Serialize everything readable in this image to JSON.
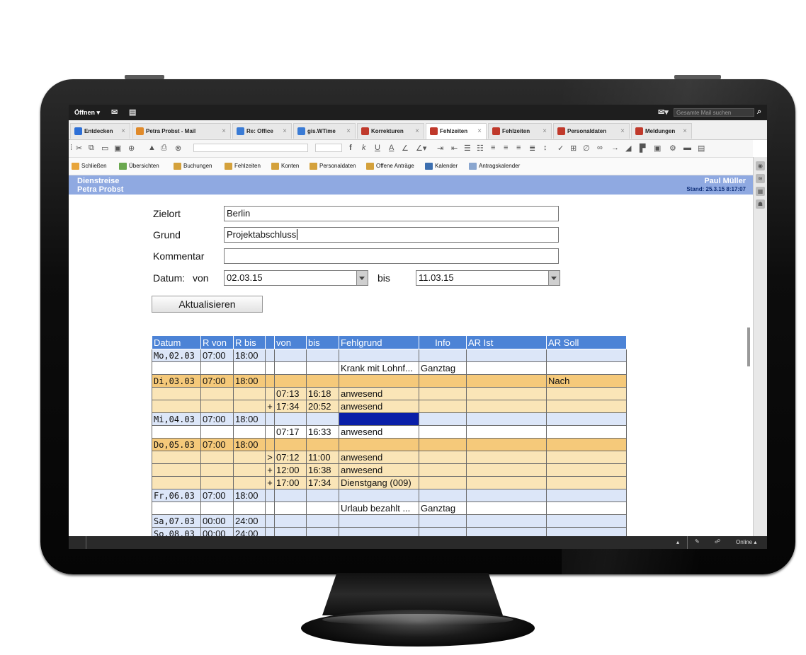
{
  "topbar": {
    "open_label": "Öffnen",
    "mail_search_placeholder": "Gesamte Mail suchen"
  },
  "tabs": [
    {
      "label": "Entdecken",
      "icon": "info-icon",
      "color": "#2d6fd6",
      "active": false
    },
    {
      "label": "Petra Probst - Mail",
      "icon": "mail-icon",
      "color": "#e08a2a",
      "active": false
    },
    {
      "label": "Re: Office",
      "icon": "reply-icon",
      "color": "#3a7bd5",
      "active": false
    },
    {
      "label": "gis.WTime",
      "icon": "app-icon",
      "color": "#3a7bd5",
      "active": false
    },
    {
      "label": "Korrekturen",
      "icon": "app-icon",
      "color": "#c0392b",
      "active": false
    },
    {
      "label": "Fehlzeiten",
      "icon": "app-icon",
      "color": "#c0392b",
      "active": true
    },
    {
      "label": "Fehlzeiten",
      "icon": "app-icon",
      "color": "#c0392b",
      "active": false
    },
    {
      "label": "Personaldaten",
      "icon": "app-icon",
      "color": "#c0392b",
      "active": false
    },
    {
      "label": "Meldungen",
      "icon": "app-icon",
      "color": "#c0392b",
      "active": false
    }
  ],
  "actions": [
    {
      "label": "Schließen",
      "icon": "close-app-icon",
      "color": "#e8a53b"
    },
    {
      "label": "Übersichten",
      "icon": "overview-icon",
      "color": "#6aa84f"
    },
    {
      "label": "Buchungen",
      "icon": "booking-icon",
      "color": "#d4a13b"
    },
    {
      "label": "Fehlzeiten",
      "icon": "absence-icon",
      "color": "#d4a13b"
    },
    {
      "label": "Konten",
      "icon": "accounts-icon",
      "color": "#d4a13b"
    },
    {
      "label": "Personaldaten",
      "icon": "person-icon",
      "color": "#d4a13b"
    },
    {
      "label": "Offene Anträge",
      "icon": "requests-icon",
      "color": "#d4a13b"
    },
    {
      "label": "Kalender",
      "icon": "calendar-icon",
      "color": "#3c6fb0"
    },
    {
      "label": "Antragskalender",
      "icon": "request-calendar-icon",
      "color": "#8aa6cf"
    }
  ],
  "header": {
    "title": "Dienstreise",
    "subtitle": "Petra Probst",
    "user": "Paul Müller",
    "stand": "Stand: 25.3.15 8:17:07"
  },
  "form": {
    "zielort_label": "Zielort",
    "zielort_value": "Berlin",
    "grund_label": "Grund",
    "grund_value": "Projektabschluss",
    "kommentar_label": "Kommentar",
    "kommentar_value": "",
    "datum_label": "Datum:",
    "von_label": "von",
    "von_value": "02.03.15",
    "bis_label": "bis",
    "bis_value": "11.03.15",
    "update_button": "Aktualisieren"
  },
  "table": {
    "headers": [
      "Datum",
      "R von",
      "R bis",
      "",
      "von",
      "bis",
      "Fehlgrund",
      "Info",
      "AR Ist",
      "AR Soll"
    ],
    "rows": [
      {
        "style": "blue",
        "cells": [
          "Mo,02.03",
          "07:00",
          "18:00",
          "",
          "",
          "",
          "",
          "",
          "",
          ""
        ]
      },
      {
        "style": "white",
        "cells": [
          "",
          "",
          "",
          "",
          "",
          "",
          "Krank mit Lohnf...",
          "Ganztag",
          "",
          ""
        ]
      },
      {
        "style": "ora",
        "cells": [
          "Di,03.03",
          "07:00",
          "18:00",
          "",
          "",
          "",
          "",
          "",
          "",
          "Nach"
        ]
      },
      {
        "style": "yel",
        "cells": [
          "",
          "",
          "",
          "",
          "07:13",
          "16:18",
          "anwesend",
          "",
          "",
          ""
        ]
      },
      {
        "style": "yel",
        "cells": [
          "",
          "",
          "",
          "+",
          "17:34",
          "20:52",
          "anwesend",
          "",
          "",
          ""
        ]
      },
      {
        "style": "blue",
        "cells": [
          "Mi,04.03",
          "07:00",
          "18:00",
          "",
          "",
          "",
          "",
          "",
          "",
          ""
        ],
        "selected_col": 6
      },
      {
        "style": "white",
        "cells": [
          "",
          "",
          "",
          "",
          "07:17",
          "16:33",
          "anwesend",
          "",
          "",
          ""
        ]
      },
      {
        "style": "ora",
        "cells": [
          "Do,05.03",
          "07:00",
          "18:00",
          "",
          "",
          "",
          "",
          "",
          "",
          ""
        ]
      },
      {
        "style": "yel",
        "cells": [
          "",
          "",
          "",
          ">",
          "07:12",
          "11:00",
          "anwesend",
          "",
          "",
          ""
        ]
      },
      {
        "style": "yel",
        "cells": [
          "",
          "",
          "",
          "+",
          "12:00",
          "16:38",
          "anwesend",
          "",
          "",
          ""
        ]
      },
      {
        "style": "yel",
        "cells": [
          "",
          "",
          "",
          "+",
          "17:00",
          "17:34",
          "Dienstgang (009)",
          "",
          "",
          ""
        ]
      },
      {
        "style": "blue",
        "cells": [
          "Fr,06.03",
          "07:00",
          "18:00",
          "",
          "",
          "",
          "",
          "",
          "",
          ""
        ]
      },
      {
        "style": "white",
        "cells": [
          "",
          "",
          "",
          "",
          "",
          "",
          "Urlaub bezahlt ...",
          "Ganztag",
          "",
          ""
        ]
      },
      {
        "style": "blue",
        "cells": [
          "Sa,07.03",
          "00:00",
          "24:00",
          "",
          "",
          "",
          "",
          "",
          "",
          ""
        ]
      },
      {
        "style": "blue",
        "cells": [
          "So,08.03",
          "00:00",
          "24:00",
          "",
          "",
          "",
          "",
          "",
          "",
          ""
        ]
      }
    ]
  },
  "statusbar": {
    "online": "Online"
  }
}
